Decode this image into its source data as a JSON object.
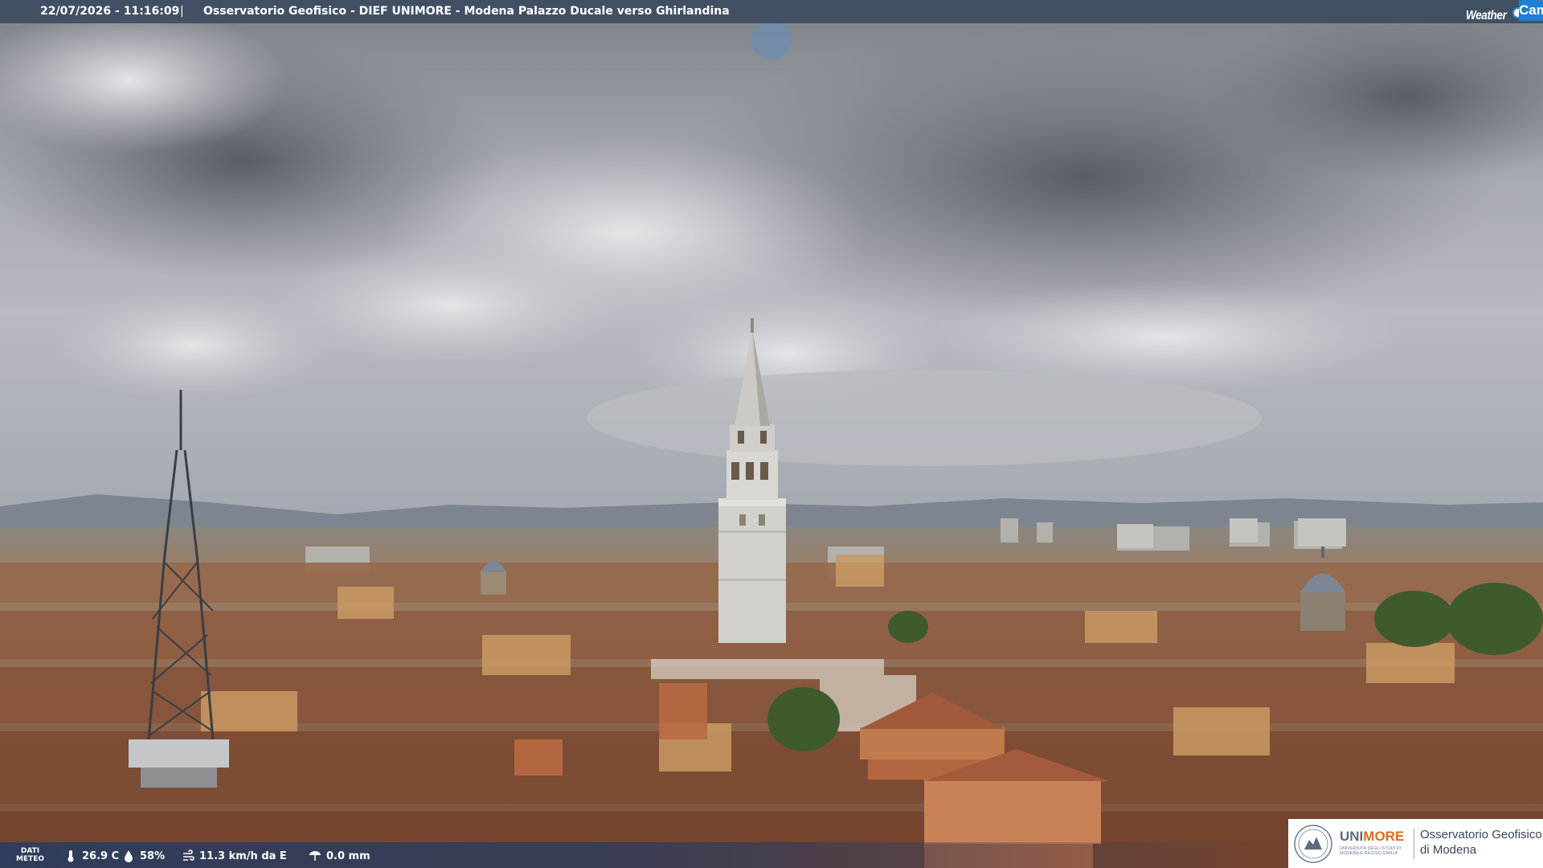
{
  "header": {
    "timestamp": "22/07/2026 - 11:16:09",
    "separator": "|",
    "title": "Osservatorio Geofisico - DIEF UNIMORE - Modena Palazzo Ducale verso Ghirlandina"
  },
  "brand": {
    "weather": "Weather",
    "cam": "Cam",
    "accent_color": "#1f7fd0"
  },
  "weather_bar": {
    "label_line1": "DATI",
    "label_line2": "METEO",
    "temperature": "26.9 C",
    "humidity": "58%",
    "wind": "11.3 km/h da E",
    "rain": "0.0 mm",
    "icons": [
      "thermometer-icon",
      "humidity-drop-icon",
      "wind-icon",
      "rain-gauge-icon"
    ]
  },
  "institution": {
    "uni_prefix": "UNI",
    "uni_suffix": "MORE",
    "uni_subtitle": "UNIVERSITÀ DEGLI STUDI DI MODENA E REGGIO EMILIA",
    "observatory_line1": "Osservatorio Geofisico",
    "observatory_line2": "di Modena",
    "brand_orange": "#e06a1c"
  }
}
